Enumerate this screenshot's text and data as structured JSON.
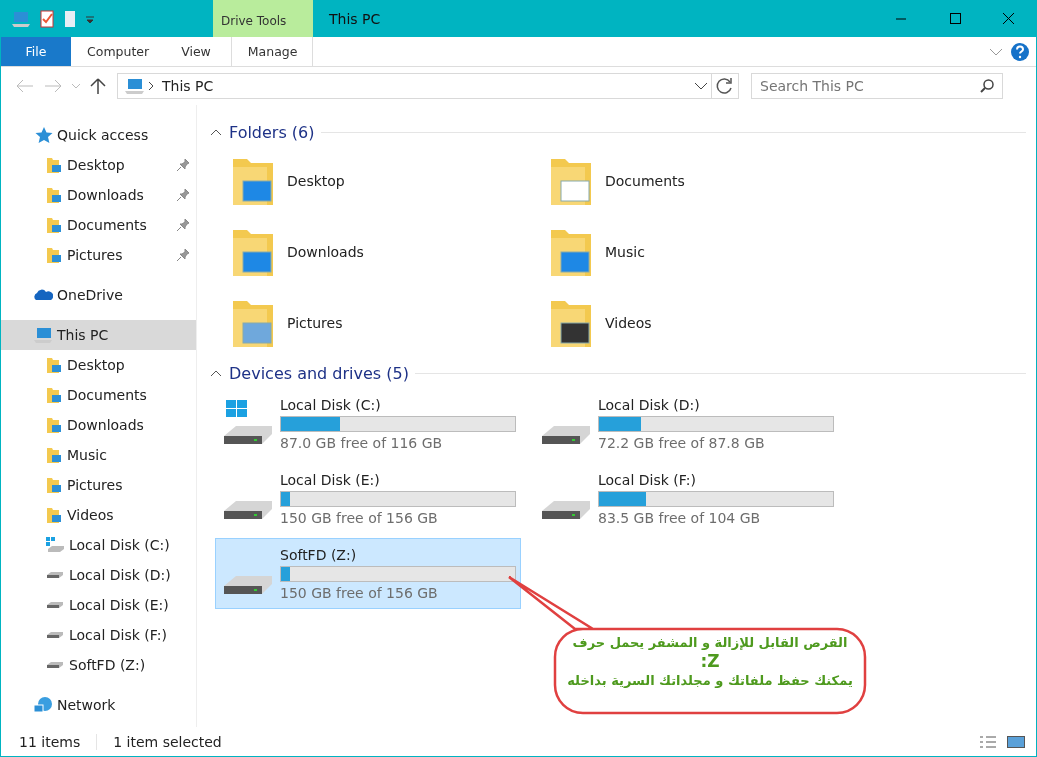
{
  "window": {
    "title": "This PC",
    "context_tab": "Drive Tools"
  },
  "ribbon_tabs": [
    {
      "label": "File",
      "kind": "file",
      "selected": false
    },
    {
      "label": "Computer",
      "kind": "tab",
      "selected": false
    },
    {
      "label": "View",
      "kind": "tab",
      "selected": false
    },
    {
      "label": "Manage",
      "kind": "context",
      "selected": false
    }
  ],
  "address": {
    "path": "This PC"
  },
  "search": {
    "placeholder": "Search This PC"
  },
  "sidebar": {
    "items": [
      {
        "label": "Quick access",
        "kind": "quick",
        "selected": false,
        "children": [
          {
            "label": "Desktop",
            "kind": "folder",
            "pinned": true,
            "selected": false
          },
          {
            "label": "Downloads",
            "kind": "folder",
            "pinned": true,
            "selected": false
          },
          {
            "label": "Documents",
            "kind": "folder",
            "pinned": true,
            "selected": false
          },
          {
            "label": "Pictures",
            "kind": "folder",
            "pinned": true,
            "selected": false
          }
        ]
      },
      {
        "label": "OneDrive",
        "kind": "cloud",
        "selected": false
      },
      {
        "label": "This PC",
        "kind": "pc",
        "selected": true,
        "children": [
          {
            "label": "Desktop",
            "kind": "folder",
            "pinned": false,
            "selected": false
          },
          {
            "label": "Documents",
            "kind": "folder",
            "pinned": false,
            "selected": false
          },
          {
            "label": "Downloads",
            "kind": "folder",
            "pinned": false,
            "selected": false
          },
          {
            "label": "Music",
            "kind": "folder",
            "pinned": false,
            "selected": false
          },
          {
            "label": "Pictures",
            "kind": "folder",
            "pinned": false,
            "selected": false
          },
          {
            "label": "Videos",
            "kind": "folder",
            "pinned": false,
            "selected": false
          },
          {
            "label": "Local Disk (C:)",
            "kind": "system",
            "pinned": false,
            "selected": false
          },
          {
            "label": "Local Disk (D:)",
            "kind": "drive",
            "pinned": false,
            "selected": false
          },
          {
            "label": "Local Disk (E:)",
            "kind": "drive",
            "pinned": false,
            "selected": false
          },
          {
            "label": "Local Disk (F:)",
            "kind": "drive",
            "pinned": false,
            "selected": false
          },
          {
            "label": "SoftFD (Z:)",
            "kind": "drive",
            "pinned": false,
            "selected": false
          }
        ]
      },
      {
        "label": "Network",
        "kind": "network",
        "selected": false
      }
    ]
  },
  "folders": {
    "title": "Folders (6)",
    "items": [
      {
        "name": "Desktop"
      },
      {
        "name": "Documents"
      },
      {
        "name": "Downloads"
      },
      {
        "name": "Music"
      },
      {
        "name": "Pictures"
      },
      {
        "name": "Videos"
      }
    ]
  },
  "drives": {
    "title": "Devices and drives (5)",
    "items": [
      {
        "name": "Local Disk (C:)",
        "kind": "system",
        "level": 0.25,
        "free": "87.0 GB free of 116 GB",
        "selected": false
      },
      {
        "name": "Local Disk (D:)",
        "kind": "drive",
        "level": 0.18,
        "free": "72.2 GB free of 87.8 GB",
        "selected": false
      },
      {
        "name": "Local Disk (E:)",
        "kind": "drive",
        "level": 0.04,
        "free": "150 GB free of 156 GB",
        "selected": false
      },
      {
        "name": "Local Disk (F:)",
        "kind": "drive",
        "level": 0.2,
        "free": "83.5 GB free of 104 GB",
        "selected": false
      },
      {
        "name": "SoftFD (Z:)",
        "kind": "drive",
        "level": 0.04,
        "free": "150 GB free of 156 GB",
        "selected": true
      }
    ]
  },
  "callout": {
    "lines": [
      "القرص القابل للإزالة و المشفر يحمل حرف",
      "Z:",
      "يمكنك حفظ ملفاتك و مجلداتك السرية بداخله"
    ]
  },
  "status_bar": {
    "count": "11 items",
    "selection": "1 item selected"
  }
}
